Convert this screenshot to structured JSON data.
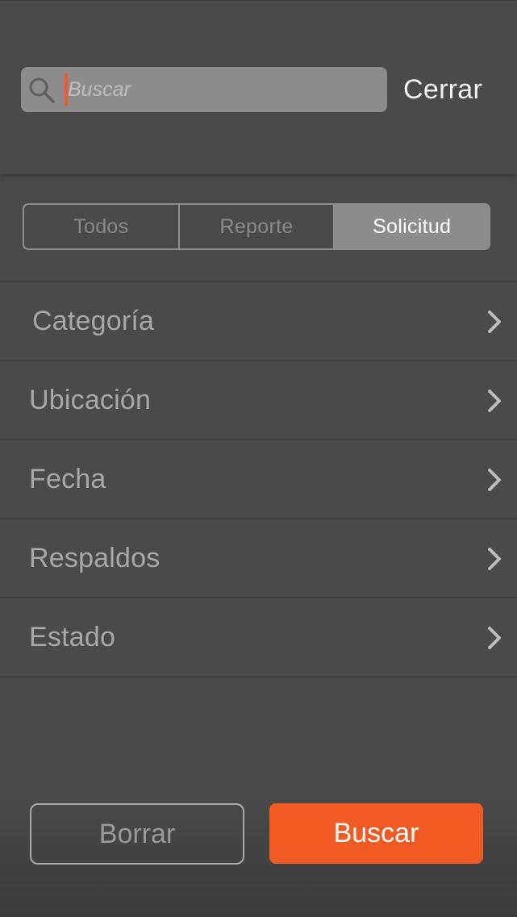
{
  "search": {
    "placeholder": "Buscar",
    "value": ""
  },
  "header": {
    "close_label": "Cerrar"
  },
  "tabs": [
    {
      "label": "Todos",
      "active": false
    },
    {
      "label": "Reporte",
      "active": false
    },
    {
      "label": "Solicitud",
      "active": true
    }
  ],
  "filters": [
    {
      "label": "Categoría"
    },
    {
      "label": "Ubicación"
    },
    {
      "label": "Fecha"
    },
    {
      "label": "Respaldos"
    },
    {
      "label": "Estado"
    }
  ],
  "actions": {
    "clear_label": "Borrar",
    "search_label": "Buscar"
  },
  "icons": {
    "search": "search-icon",
    "row_arrow": "chevron-right-icon"
  },
  "colors": {
    "accent": "#f15a22",
    "background": "#4a4a4a",
    "active_tab": "#8c8c8c"
  }
}
